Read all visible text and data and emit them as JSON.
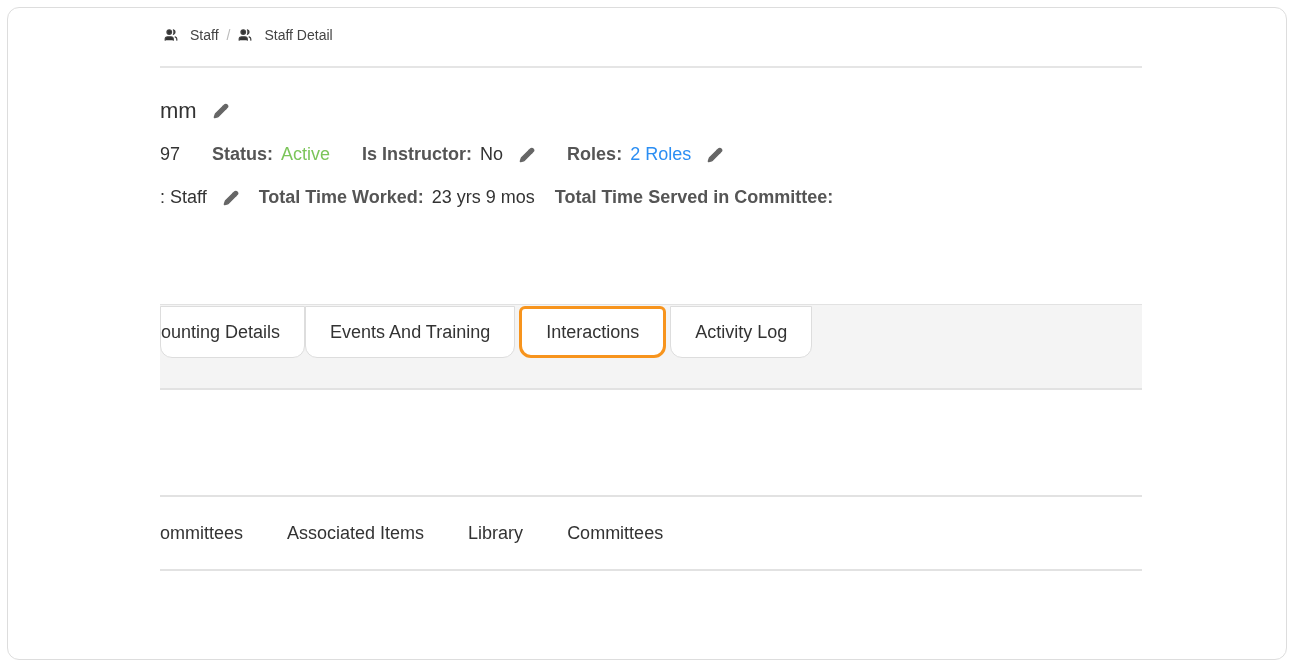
{
  "breadcrumb": [
    "Staff",
    "Staff Detail"
  ],
  "breadcrumb_separator": "/",
  "name": "mm",
  "details_row_1": [
    {
      "kind": "plain",
      "value": "97"
    },
    {
      "kind": "pair",
      "label": "Status:",
      "value": "Active",
      "color": "#7cc55a"
    },
    {
      "kind": "pair",
      "label": "Is Instructor:",
      "value": "No",
      "editable": true
    },
    {
      "kind": "pair",
      "label": "Roles:",
      "value": "2 Roles",
      "color": "#2b8ef3",
      "editable": true
    }
  ],
  "details_row_2": [
    {
      "kind": "plain",
      "value": ": Staff",
      "editable": true
    },
    {
      "kind": "pair",
      "label": "Total Time Worked:",
      "value": "23 yrs 9 mos"
    },
    {
      "kind": "pair",
      "label": "Total Time Served in Committee:"
    }
  ],
  "tabs": [
    {
      "label": "ounting Details",
      "selected": false
    },
    {
      "label": "Events And Training",
      "selected": false
    },
    {
      "label": "Interactions",
      "selected": true
    },
    {
      "label": "Activity Log",
      "selected": false
    }
  ],
  "sub_tabs": [
    "ommittees",
    "Associated Items",
    "Library",
    "Committees"
  ]
}
